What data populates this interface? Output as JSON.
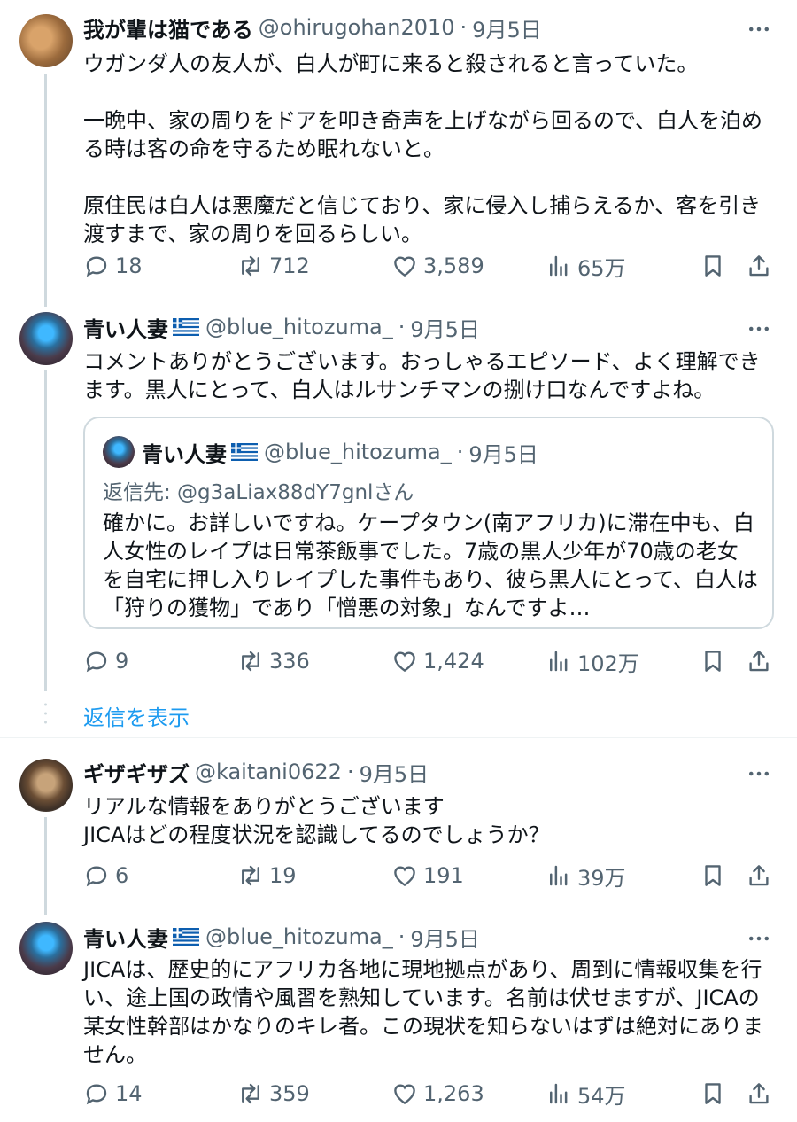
{
  "tweets": [
    {
      "name": "我が輩は猫である",
      "handle": "@ohirugohan2010",
      "separator": "·",
      "date": "9月5日",
      "text": "ウガンダ人の友人が、白人が町に来ると殺されると言っていた。\n\n一晩中、家の周りをドアを叩き奇声を上げながら回るので、白人を泊める時は客の命を守るため眠れないと。\n\n原住民は白人は悪魔だと信じており、家に侵入し捕らえるか、客を引き渡すまで、家の周りを回るらしい。",
      "replies": "18",
      "retweets": "712",
      "likes": "3,589",
      "views": "65万"
    },
    {
      "name": "青い人妻",
      "handle": "@blue_hitozuma_",
      "separator": "·",
      "date": "9月5日",
      "text": "コメントありがとうございます。おっしゃるエピソード、よく理解できます。黒人にとって、白人はルサンチマンの捌け口なんですよね。",
      "quote": {
        "name": "青い人妻",
        "handle": "@blue_hitozuma_",
        "separator": "·",
        "date": "9月5日",
        "reply_to": "返信先: @g3aLiax88dY7gnlさん",
        "text": "確かに。お詳しいですね。ケープタウン(南アフリカ)に滞在中も、白人女性のレイプは日常茶飯事でした。7歳の黒人少年が70歳の老女を自宅に押し入りレイプした事件もあり、彼ら黒人にとって、白人は「狩りの獲物」であり「憎悪の対象」なんですよ…"
      },
      "replies": "9",
      "retweets": "336",
      "likes": "1,424",
      "views": "102万"
    },
    {
      "name": "ギザギザズ",
      "handle": "@kaitani0622",
      "separator": "·",
      "date": "9月5日",
      "text": "リアルな情報をありがとうございます\nJICAはどの程度状況を認識してるのでしょうか？",
      "replies": "6",
      "retweets": "19",
      "likes": "191",
      "views": "39万"
    },
    {
      "name": "青い人妻",
      "handle": "@blue_hitozuma_",
      "separator": "·",
      "date": "9月5日",
      "text": "JICAは、歴史的にアフリカ各地に現地拠点があり、周到に情報収集を行い、途上国の政情や風習を熟知しています。名前は伏せますが、JICAの某女性幹部はかなりのキレ者。この現状を知らないはずは絶対にありません。",
      "replies": "14",
      "retweets": "359",
      "likes": "1,263",
      "views": "54万"
    }
  ],
  "show_replies_label": "返信を表示",
  "icons": [
    "more-icon",
    "reply-icon",
    "retweet-icon",
    "like-icon",
    "views-icon",
    "bookmark-icon",
    "share-icon",
    "greek-flag-icon"
  ],
  "colors": {
    "link": "#1d9bf0",
    "muted": "#536471",
    "text": "#0f1419",
    "border": "#cfd9de"
  }
}
